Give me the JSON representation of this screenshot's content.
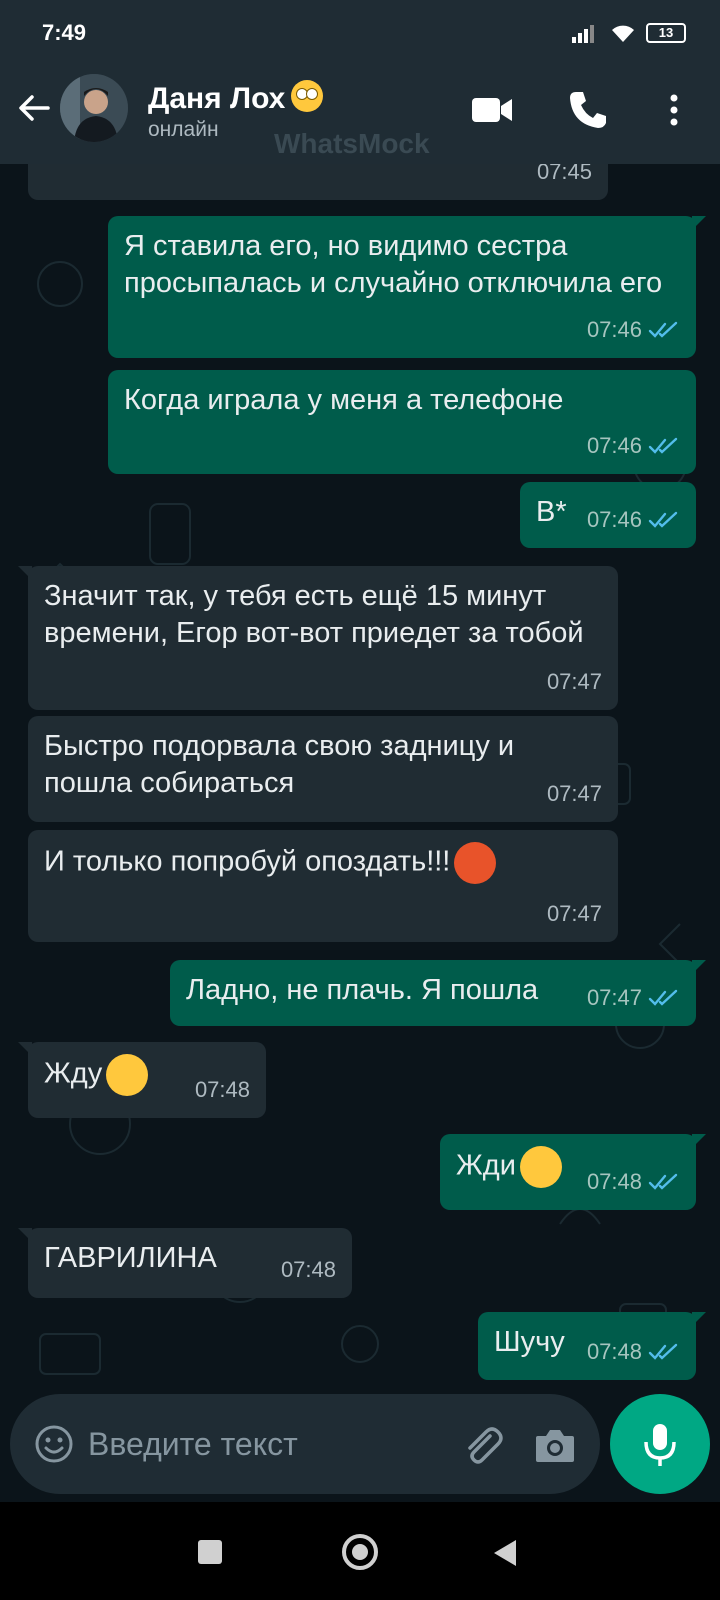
{
  "status_bar": {
    "time": "7:49",
    "battery": "13"
  },
  "header": {
    "contact_name": "Даня Лох",
    "contact_status": "онлайн",
    "watermark": "WhatsMock"
  },
  "messages": [
    {
      "direction": "in",
      "text": "",
      "time": "07:45"
    },
    {
      "direction": "out",
      "text": "Я ставила его, но видимо сестра просыпалась и случайно отключила его",
      "time": "07:46",
      "read": true
    },
    {
      "direction": "out",
      "text": "Когда играла у меня а телефоне",
      "time": "07:46",
      "read": true
    },
    {
      "direction": "out",
      "text": "В*",
      "time": "07:46",
      "read": true
    },
    {
      "direction": "in",
      "text": "Значит так, у тебя есть ещё 15 минут времени, Егор вот-вот приедет за тобой",
      "time": "07:47"
    },
    {
      "direction": "in",
      "text": "Быстро подорвала свою задницу и пошла собираться",
      "time": "07:47"
    },
    {
      "direction": "in",
      "text": "И только попробуй опоздать!!!",
      "emoji": "angry-face-emoji",
      "time": "07:47"
    },
    {
      "direction": "out",
      "text": "Ладно, не плачь. Я пошла",
      "time": "07:47",
      "read": true
    },
    {
      "direction": "in",
      "text": "Жду",
      "emoji": "annoyed-face-emoji",
      "time": "07:48"
    },
    {
      "direction": "out",
      "text": "Жди",
      "emoji": "smirking-face-emoji",
      "time": "07:48",
      "read": true
    },
    {
      "direction": "in",
      "text": "ГАВРИЛИНА",
      "time": "07:48"
    },
    {
      "direction": "out",
      "text": "Шучу",
      "time": "07:48",
      "read": true
    }
  ],
  "input": {
    "placeholder": "Введите текст"
  },
  "colors": {
    "outgoing_bubble": "#005c4b",
    "incoming_bubble": "#202c33",
    "read_ticks": "#53bdeb",
    "accent": "#00a884"
  }
}
